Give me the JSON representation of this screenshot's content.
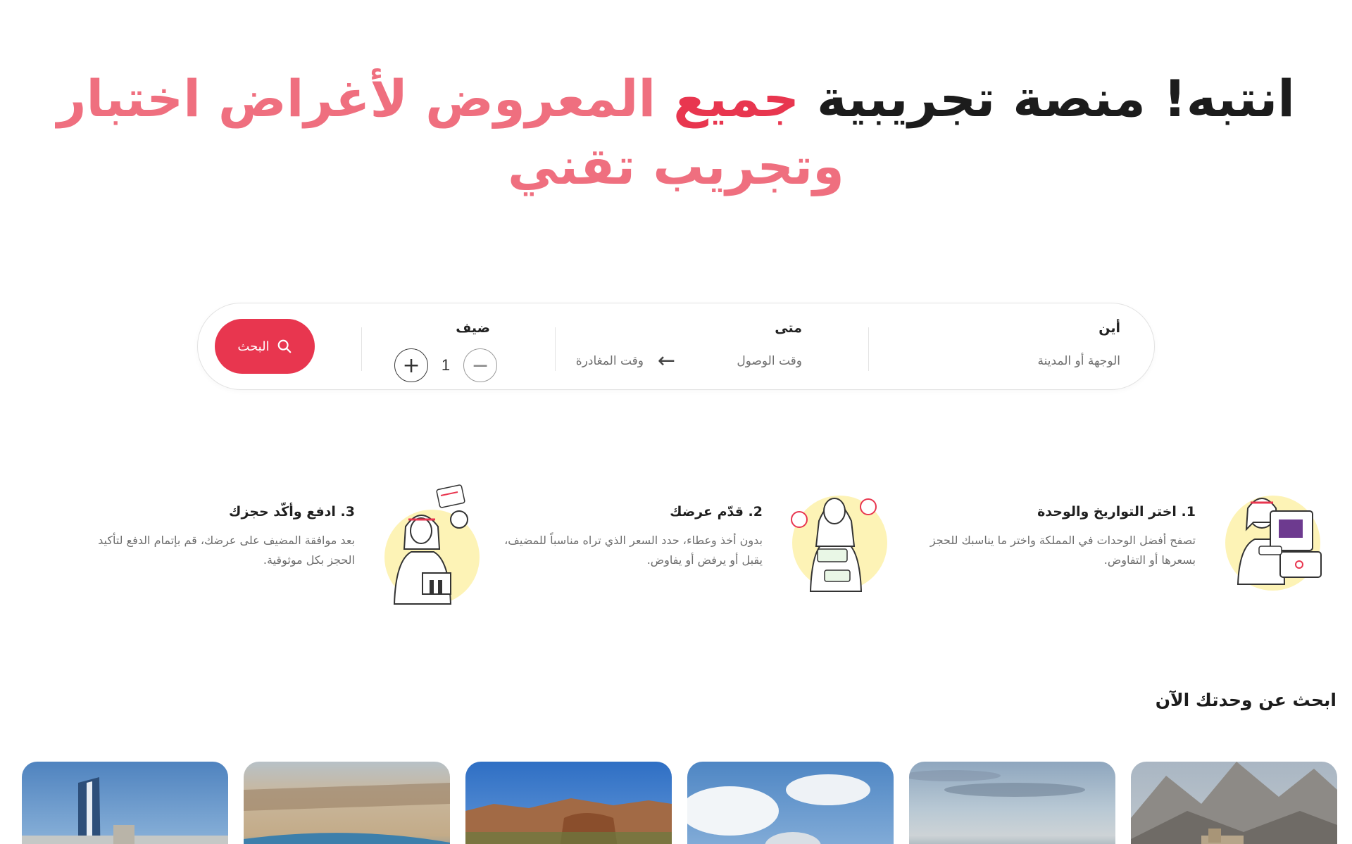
{
  "hero": {
    "part1": "انتبه! منصة تجريبية",
    "part2": "جميع",
    "part3": "المعروض لأغراض اختبار وتجريب تقني"
  },
  "search": {
    "where": {
      "title": "أين",
      "placeholder": "الوجهة أو المدينة"
    },
    "when": {
      "title": "متى",
      "arrival": "وقت الوصول",
      "departure": "وقت المغادرة",
      "arrow": "arrow-left-icon"
    },
    "guest": {
      "title": "ضيف",
      "count": "1",
      "minus": "−",
      "plus": "+"
    },
    "button_label": "البحث",
    "button_icon": "search-icon"
  },
  "steps": [
    {
      "title": "1. اختر التواريخ والوحدة",
      "desc": "تصفح أفضل الوحدات في المملكة واختر ما يناسبك للحجز بسعرها أو التفاوض."
    },
    {
      "title": "2. قدّم عرضك",
      "desc": "بدون أخذ وعطاء، حدد السعر الذي تراه مناسباً للمضيف، يقبل أو يرفض أو يفاوض."
    },
    {
      "title": "3. ادفع وأكّد حجزك",
      "desc": "بعد موافقة المضيف على عرضك، قم بإتمام الدفع لتأكيد الحجز بكل موثوقية."
    }
  ],
  "listing": {
    "title": "ابحث عن وحدتك الآن"
  },
  "colors": {
    "accent": "#e8364f",
    "accent_light": "#ef6f7f",
    "highlight": "#fdf3b6"
  }
}
